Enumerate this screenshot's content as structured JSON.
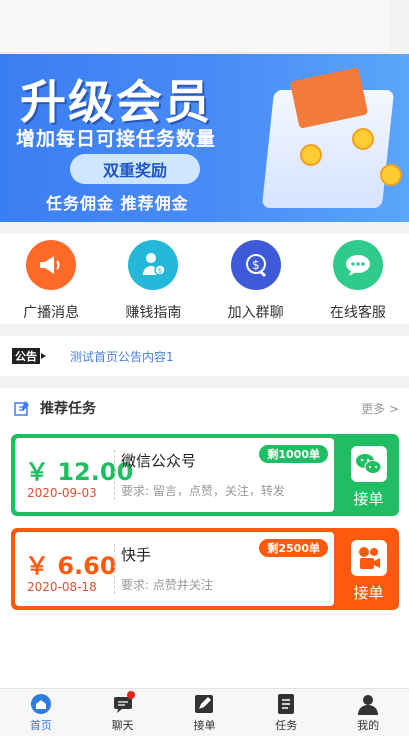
{
  "banner": {
    "title": "升级会员",
    "subtitle": "增加每日可接任务数量",
    "pill": "双重奖励",
    "tags": "任务佣金  推荐佣金"
  },
  "quick_icons": [
    {
      "label": "广播消息",
      "icon": "broadcast-icon",
      "color": "#ff6a28"
    },
    {
      "label": "赚钱指南",
      "icon": "guide-icon",
      "color": "#23b8d8"
    },
    {
      "label": "加入群聊",
      "icon": "group-chat-icon",
      "color": "#3f5ad8"
    },
    {
      "label": "在线客服",
      "icon": "service-icon",
      "color": "#2fcb8a"
    }
  ],
  "notice": {
    "badge": "公告",
    "text": "测试首页公告内容1"
  },
  "tasks_section": {
    "title": "推荐任务",
    "more": "更多 >"
  },
  "tasks": [
    {
      "price": "￥ 12.00",
      "date": "2020-09-03",
      "name": "微信公众号",
      "requirement": "要求: 留言，点赞，关注，转发",
      "remaining": "剩1000单",
      "action": "接单",
      "icon": "wechat-icon",
      "color": "#1fbe62"
    },
    {
      "price": "￥ 6.60",
      "date": "2020-08-18",
      "name": "快手",
      "requirement": "要求: 点赞并关注",
      "remaining": "剩2500单",
      "action": "接单",
      "icon": "kuaishou-icon",
      "color": "#ff5a0d"
    }
  ],
  "tabbar": [
    {
      "label": "首页",
      "icon": "home-icon",
      "active": true
    },
    {
      "label": "聊天",
      "icon": "chat-icon",
      "active": false
    },
    {
      "label": "接单",
      "icon": "edit-icon",
      "active": false
    },
    {
      "label": "任务",
      "icon": "task-list-icon",
      "active": false
    },
    {
      "label": "我的",
      "icon": "profile-icon",
      "active": false
    }
  ]
}
